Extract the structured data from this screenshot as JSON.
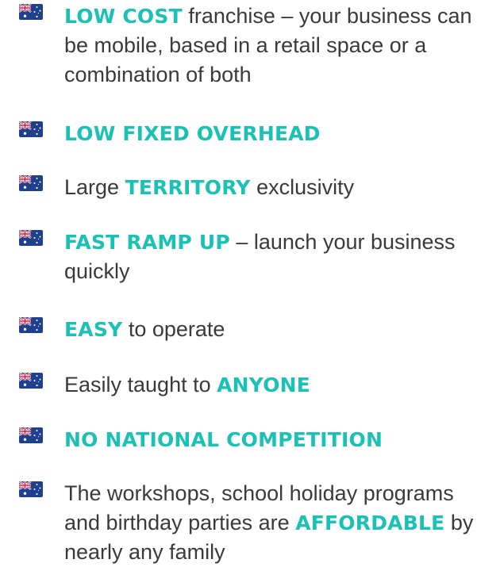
{
  "accent_color": "#19c2b4",
  "bullet_icon": "australia-flag-icon",
  "items": [
    {
      "highlight": "LOW COST",
      "after": " franchise – your business can be mobile, based in a retail space or a combination of both"
    },
    {
      "highlight": "LOW FIXED OVERHEAD"
    },
    {
      "before": "Large ",
      "highlight": "TERRITORY",
      "after": " exclusivity"
    },
    {
      "highlight": "FAST RAMP UP",
      "after": " – launch your business quickly"
    },
    {
      "highlight": "EASY",
      "after": " to operate"
    },
    {
      "before": "Easily taught to ",
      "highlight": "ANYONE"
    },
    {
      "highlight": "NO NATIONAL COMPETITION"
    },
    {
      "before": "The workshops, school holiday programs and birthday parties are ",
      "highlight": "AFFORDABLE",
      "after": " by nearly any family"
    }
  ]
}
